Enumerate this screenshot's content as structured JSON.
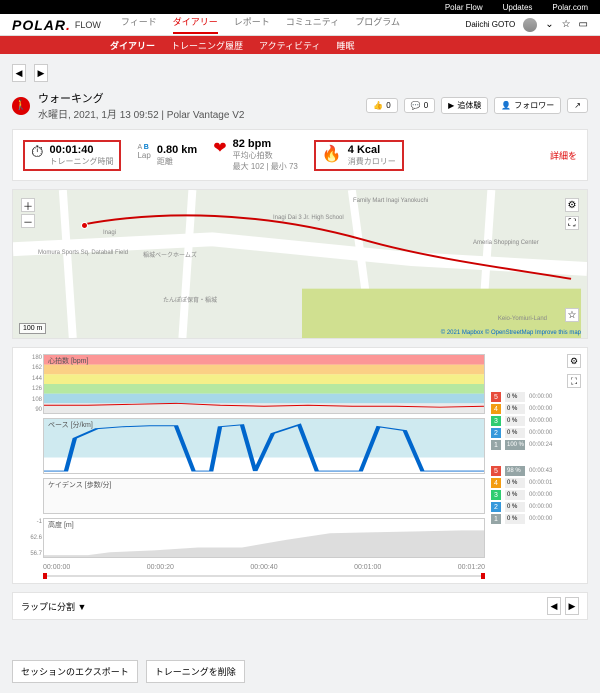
{
  "topbar": {
    "flow": "Polar Flow",
    "updates": "Updates",
    "polarcom": "Polar.com"
  },
  "logo": {
    "text": "POLAR",
    "flow": "FLOW"
  },
  "mainnav": {
    "feed": "フィード",
    "diary": "ダイアリー",
    "report": "レポート",
    "community": "コミュニティ",
    "program": "プログラム"
  },
  "user": {
    "name": "Daiichi GOTO"
  },
  "subnav": {
    "diary": "ダイアリー",
    "history": "トレーニング履歴",
    "activity": "アクティビティ",
    "sleep": "睡眠"
  },
  "session": {
    "sport": "ウォーキング",
    "datetime": "水曜日, 2021, 1月 13 09:52 | Polar Vantage V2"
  },
  "social": {
    "like": "0",
    "comment": "0",
    "relive": "追体験",
    "followers": "フォロワー"
  },
  "stats": {
    "duration_val": "00:01:40",
    "duration_lbl": "トレーニング時間",
    "ab_prefix": "A ",
    "ab_b": "B",
    "distance_val": "0.80 km",
    "distance_lbl": "距離",
    "hr_val": "82 bpm",
    "hr_lbl": "平均心拍数",
    "hr_detail": "最大 102 | 最小 73",
    "kcal_val": "4 Kcal",
    "kcal_lbl": "消費カロリー",
    "details": "詳細を"
  },
  "map": {
    "scale": "100 m",
    "attr": "© 2021 Mapbox © OpenStreetMap Improve this map",
    "pois": {
      "family": "Family Mart\nInagi Yanokuchi",
      "ameria": "Ameria\nShopping Center",
      "inagi": "Inagi",
      "momura": "Momura Sports\nSq. Databall Field",
      "inagidai": "Inagi Dai 3 Jr.\nHigh School",
      "tanpopo": "たんぽぽ保育・稲城",
      "castle": "稲城ベークホームズ",
      "keio": "Keio-Yomiuri-Land"
    }
  },
  "chart_data": {
    "hr": {
      "label": "心拍数 [bpm]",
      "yticks": [
        180,
        162,
        144,
        126,
        108,
        90
      ],
      "series": [
        90,
        90,
        91,
        92,
        90,
        88,
        89,
        88,
        88,
        87,
        88,
        88
      ]
    },
    "pace": {
      "label": "ペース [分/km]",
      "series": [
        0,
        20,
        60,
        62,
        63,
        65,
        65,
        0,
        0,
        64,
        65,
        0,
        60,
        65,
        0,
        0,
        0,
        63,
        60,
        0,
        0
      ]
    },
    "cadence": {
      "label": "ケイデンス [歩数/分]",
      "yticks": [
        "-",
        "-"
      ]
    },
    "alt": {
      "label": "高度 [m]",
      "yticks": [
        "-1",
        "62.6",
        "56.7"
      ],
      "series": [
        56.7,
        56.7,
        57.5,
        58,
        59,
        60,
        60,
        61,
        62,
        62.2,
        62.2,
        62.3,
        62.5,
        62.6
      ]
    },
    "xticks": [
      "00:00:00",
      "00:00:20",
      "00:00:40",
      "00:01:00",
      "00:01:20"
    ]
  },
  "zones": {
    "hr": [
      {
        "n": 5,
        "c": "z5",
        "p": "0 %",
        "t": "00:00:00"
      },
      {
        "n": 4,
        "c": "z4",
        "p": "0 %",
        "t": "00:00:00"
      },
      {
        "n": 3,
        "c": "z3",
        "p": "0 %",
        "t": "00:00:00"
      },
      {
        "n": 2,
        "c": "z2",
        "p": "0 %",
        "t": "00:00:00"
      },
      {
        "n": 1,
        "c": "z1",
        "p": "100 %",
        "t": "00:00:24",
        "fill": true
      }
    ],
    "pace": [
      {
        "n": 5,
        "c": "z5",
        "p": "98 %",
        "t": "00:00:43",
        "fill": true
      },
      {
        "n": 4,
        "c": "z4",
        "p": "0 %",
        "t": "00:00:01"
      },
      {
        "n": 3,
        "c": "z3",
        "p": "0 %",
        "t": "00:00:00"
      },
      {
        "n": 2,
        "c": "z2",
        "p": "0 %",
        "t": "00:00:00"
      },
      {
        "n": 1,
        "c": "z1",
        "p": "0 %",
        "t": "00:00:00"
      }
    ]
  },
  "lapbar": {
    "label": "ラップに分割 ▼"
  },
  "footer": {
    "export": "セッションのエクスポート",
    "delete": "トレーニングを削除"
  }
}
